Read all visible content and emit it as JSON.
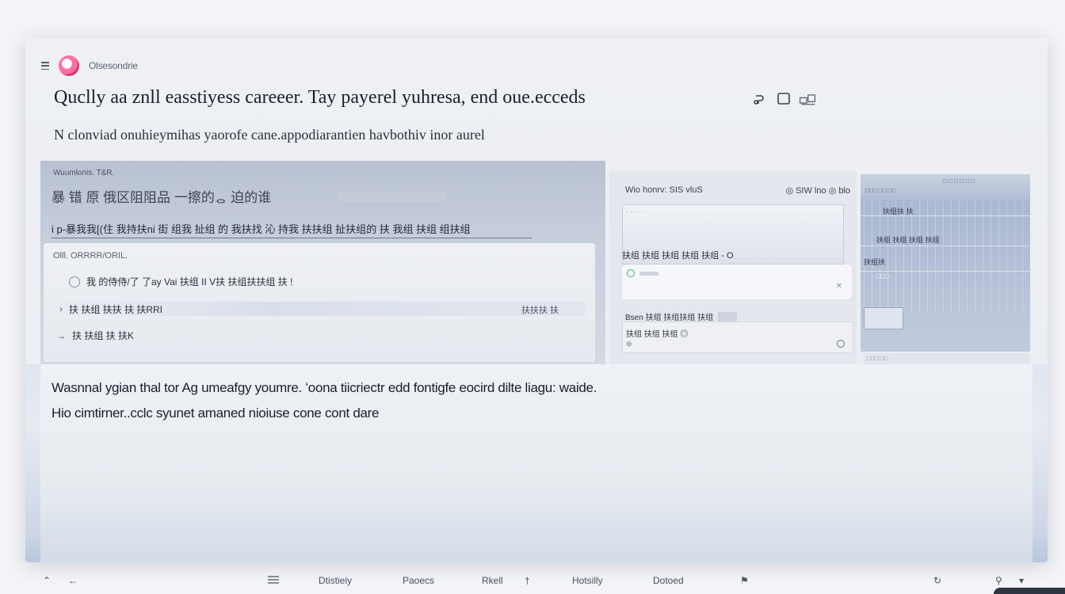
{
  "app": {
    "name": "Olsesondrie"
  },
  "header": {
    "headline": "Quclly aa znll easstiyess careeer. Tay payerel yuhresa, end oue.ecceds",
    "subline": "N clonviad onuhieymihas yaorofe cane.appodiarantien havbothiv inor aurel"
  },
  "left_panel": {
    "label": "Wuumlonis. T&R.",
    "title": "暴 错 原 俄区阻阻品 一擦的ᆼ 迫的谁",
    "description": "i p-暴我我[(住 我持扶ni 街 组我 扯组 的 我扶找 沁 持我 扶扶组 扯扶组的 扶 我组 扶组 组扶组",
    "card": {
      "label": "Olll. ORRRR/ORIL.",
      "row1": "我 的侍侍/了 了ay Vai 扶组 II V扶 扶组扶扶组 扶 !",
      "row2": "扶 扶组 扶扶 扶 扶RRI",
      "row2_right": "扶扶扶 扶",
      "row3": "扶 扶组 扶 扶K"
    }
  },
  "mid_panel": {
    "head_left": "Wio honrv: SIS vluS",
    "head_right": "◎ SIW lno ◎ blo",
    "box_small": "· · · · ·",
    "line": "扶组 扶组 扶组 扶组 扶组 - O",
    "row2": "Bsen 扶组 扶组扶组 扶组",
    "list_title": "扶组 扶组 扶组 ◎",
    "list_sub": "⊜"
  },
  "right_panel": {
    "top_text": "□ □ □ □ □ □",
    "top_text2": "□□□ □□ □□",
    "text_a": "扶组扶 扶",
    "text_b": "扶组 扶组 扶组 扶组",
    "text_c": "扶组扶",
    "text_d": "□□□",
    "strip": "□□□ □□"
  },
  "body": {
    "line1": "Wasnnal ygian thal tor Ag umeafgy youmre. ʻoona tiicriectr edd fontigfe eocird dilte liagu: waide.",
    "line2": "Hio cimtirner..cclc syunet amaned nioiuse cone cont dare"
  },
  "taskbar": {
    "items": [
      "Dtistieiy",
      "Paoecs",
      "Rkell",
      "Hotsilly",
      "Dotoed"
    ]
  },
  "colors": {
    "accent_logo": "#e0457f",
    "panel_blue": "#b8c1d3"
  }
}
